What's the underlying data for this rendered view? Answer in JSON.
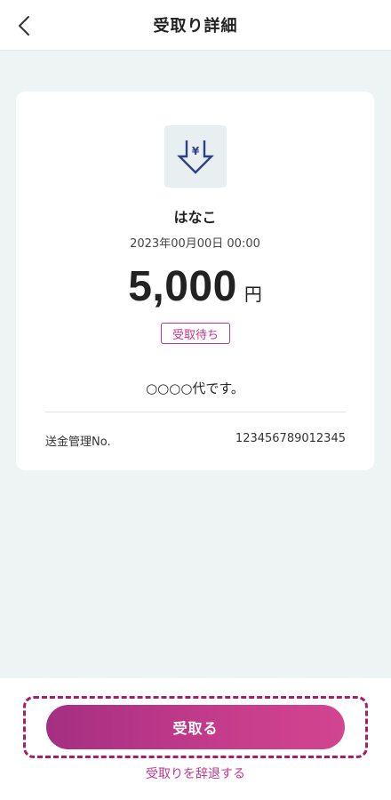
{
  "header": {
    "title": "受取り詳細",
    "back_icon": "chevron-left-icon"
  },
  "card": {
    "icon": "yen-receive-icon",
    "sender_name": "はなこ",
    "date": "2023年00月00日 00:00",
    "amount": "5,000",
    "currency": "円",
    "status": "受取待ち",
    "message": "○○○○代です。",
    "transfer_label": "送金管理No.",
    "transfer_number": "123456789012345"
  },
  "footer": {
    "receive_button": "受取る",
    "decline_link": "受取りを辞退する"
  },
  "colors": {
    "accent": "#c6358a",
    "button_gradient_start": "#a42f82",
    "button_gradient_end": "#d2458f",
    "icon_color": "#2f3f86",
    "background": "#eef3f3"
  }
}
